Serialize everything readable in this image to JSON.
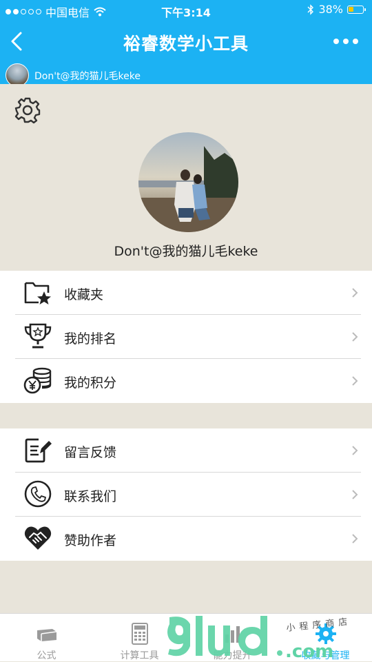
{
  "status_bar": {
    "carrier": "中国电信",
    "time": "下午3:14",
    "battery": "38%",
    "battery_level": 0.38,
    "signal_dots_filled": 2,
    "signal_dots_total": 5
  },
  "nav": {
    "title": "裕睿数学小工具",
    "back_icon": "chevron-left-icon",
    "more_icon": "more-dots-icon"
  },
  "user_bar": {
    "name": "Don't@我的猫儿毛keke"
  },
  "profile": {
    "name": "Don't@我的猫儿毛keke",
    "settings_icon": "gear-icon"
  },
  "menu_group_1": [
    {
      "label": "收藏夹",
      "icon": "folder-star-icon"
    },
    {
      "label": "我的排名",
      "icon": "trophy-icon"
    },
    {
      "label": "我的积分",
      "icon": "coins-icon"
    }
  ],
  "menu_group_2": [
    {
      "label": "留言反馈",
      "icon": "feedback-edit-icon"
    },
    {
      "label": "联系我们",
      "icon": "phone-icon"
    },
    {
      "label": "赞助作者",
      "icon": "heart-handshake-icon"
    }
  ],
  "tabs": [
    {
      "label": "公式",
      "icon": "book-icon"
    },
    {
      "label": "计算工具",
      "icon": "calculator-icon"
    },
    {
      "label": "能力提升",
      "icon": "chart-icon"
    },
    {
      "label": "收藏与管理",
      "icon": "gear-icon"
    }
  ],
  "watermark": {
    "brand": "91ud",
    "suffix": ".com",
    "tagline": "小程序商店"
  },
  "colors": {
    "accent": "#1cb2f3",
    "background": "#e8e4da",
    "watermark_green": "#5fd3a6"
  }
}
